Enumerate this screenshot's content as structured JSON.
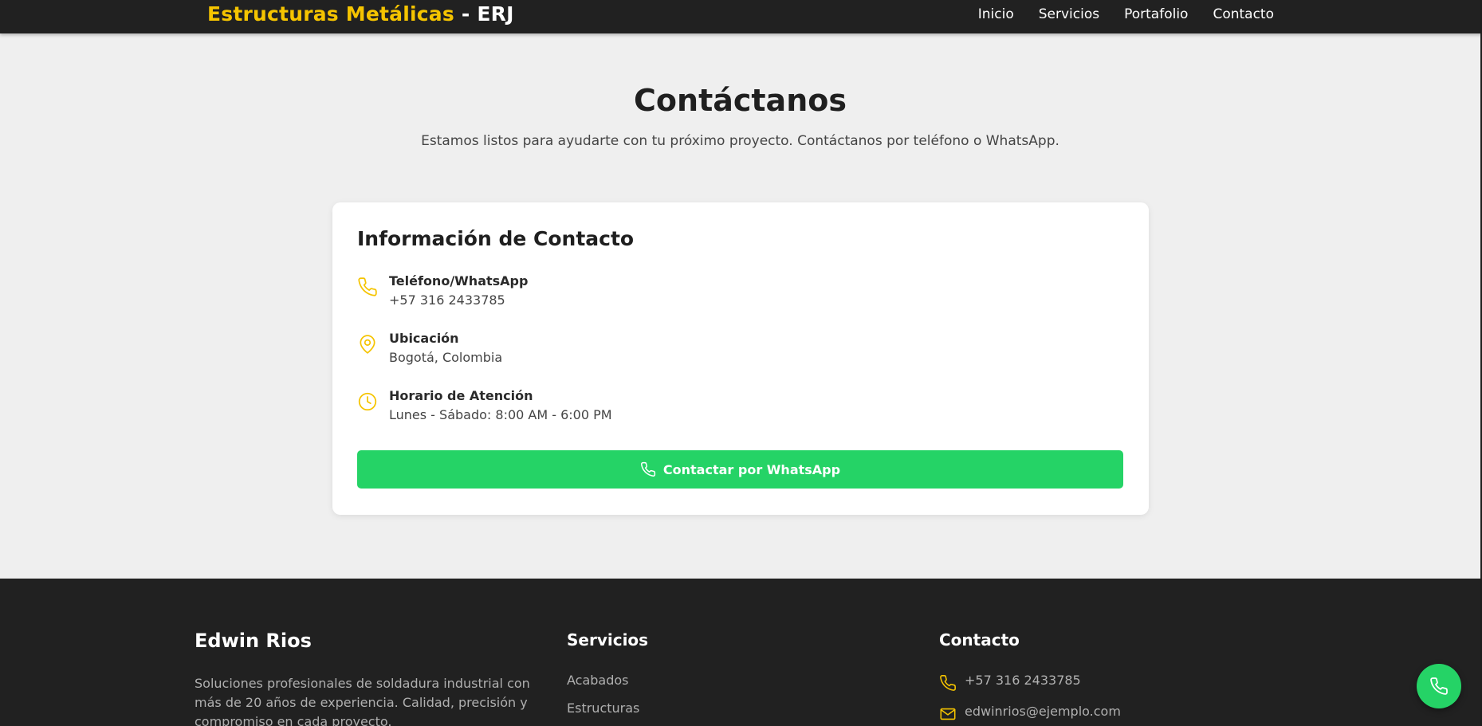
{
  "header": {
    "brand_primary": "Estructuras Metálicas",
    "brand_secondary": " - ERJ",
    "nav": [
      "Inicio",
      "Servicios",
      "Portafolio",
      "Contacto"
    ]
  },
  "hero": {
    "title": "Contáctanos",
    "subtitle": "Estamos listos para ayudarte con tu próximo proyecto. Contáctanos por teléfono o WhatsApp."
  },
  "contact_card": {
    "title": "Información de Contacto",
    "items": [
      {
        "icon": "phone-icon",
        "label": "Teléfono/WhatsApp",
        "value": "+57 316 2433785"
      },
      {
        "icon": "location-pin-icon",
        "label": "Ubicación",
        "value": "Bogotá, Colombia"
      },
      {
        "icon": "clock-icon",
        "label": "Horario de Atención",
        "value": "Lunes - Sábado: 8:00 AM - 6:00 PM"
      }
    ],
    "button_label": "Contactar por WhatsApp"
  },
  "footer": {
    "about": {
      "name": "Edwin Rios",
      "description": "Soluciones profesionales de soldadura industrial con más de 20 años de experiencia. Calidad, precisión y compromiso en cada proyecto."
    },
    "services": {
      "heading": "Servicios",
      "links": [
        "Acabados",
        "Estructuras"
      ]
    },
    "contact": {
      "heading": "Contacto",
      "phone": "+57 316 2433785",
      "email": "edwinrios@ejemplo.com"
    }
  },
  "colors": {
    "accent": "#f5c400",
    "whatsapp_green": "#25d366",
    "dark": "#212121",
    "page_bg": "#efefef"
  }
}
